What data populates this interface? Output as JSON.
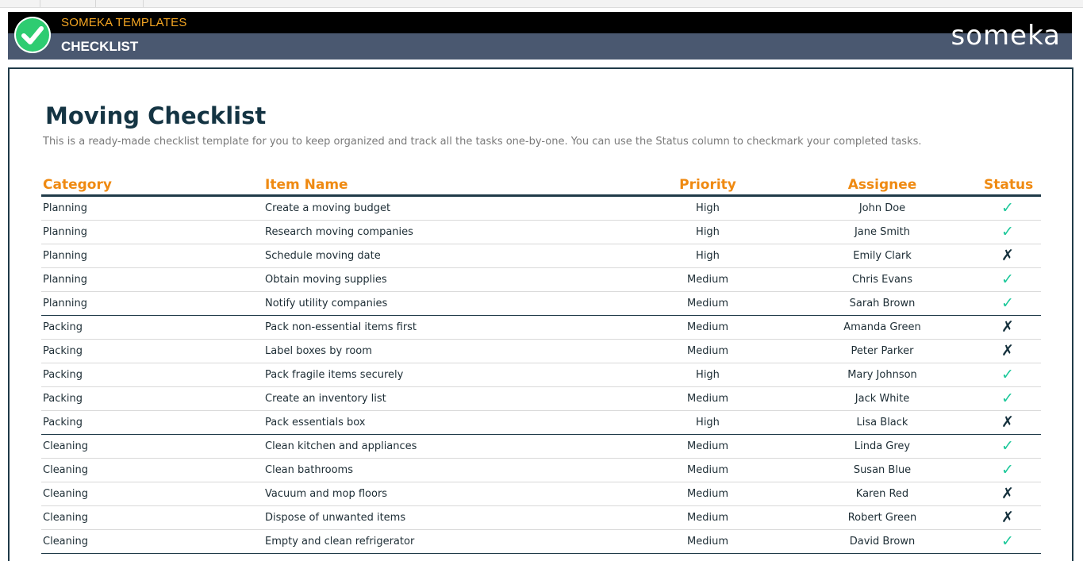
{
  "header": {
    "brand": "SOMEKA TEMPLATES",
    "title": "CHECKLIST",
    "logo_text": "someka",
    "check_icon": "check-circle-icon",
    "accent_color": "#f5a623",
    "band_color": "#4a5870"
  },
  "main": {
    "title": "Moving Checklist",
    "description": "This is a ready-made checklist template for you to keep organized and track all the tasks one-by-one. You can use the Status column to checkmark your completed tasks."
  },
  "table": {
    "columns": {
      "category": "Category",
      "item_name": "Item Name",
      "priority": "Priority",
      "assignee": "Assignee",
      "status": "Status"
    },
    "header_color": "#ef8a12",
    "status_done_symbol": "✓",
    "status_not_done_symbol": "✗",
    "status_done_color": "#1cc89a",
    "status_not_done_color": "#14303c",
    "rows": [
      {
        "category": "Planning",
        "item": "Create a moving budget",
        "priority": "High",
        "assignee": "John Doe",
        "status": "✓"
      },
      {
        "category": "Planning",
        "item": "Research moving companies",
        "priority": "High",
        "assignee": "Jane Smith",
        "status": "✓"
      },
      {
        "category": "Planning",
        "item": "Schedule moving date",
        "priority": "High",
        "assignee": "Emily Clark",
        "status": "✗"
      },
      {
        "category": "Planning",
        "item": "Obtain moving supplies",
        "priority": "Medium",
        "assignee": "Chris Evans",
        "status": "✓"
      },
      {
        "category": "Planning",
        "item": "Notify utility companies",
        "priority": "Medium",
        "assignee": "Sarah Brown",
        "status": "✓"
      },
      {
        "category": "Packing",
        "item": "Pack non-essential items first",
        "priority": "Medium",
        "assignee": "Amanda Green",
        "status": "✗"
      },
      {
        "category": "Packing",
        "item": "Label boxes by room",
        "priority": "Medium",
        "assignee": "Peter Parker",
        "status": "✗"
      },
      {
        "category": "Packing",
        "item": "Pack fragile items securely",
        "priority": "High",
        "assignee": "Mary Johnson",
        "status": "✓"
      },
      {
        "category": "Packing",
        "item": "Create an inventory list",
        "priority": "Medium",
        "assignee": "Jack White",
        "status": "✓"
      },
      {
        "category": "Packing",
        "item": "Pack essentials box",
        "priority": "High",
        "assignee": "Lisa Black",
        "status": "✗"
      },
      {
        "category": "Cleaning",
        "item": "Clean kitchen and appliances",
        "priority": "Medium",
        "assignee": "Linda Grey",
        "status": "✓"
      },
      {
        "category": "Cleaning",
        "item": "Clean bathrooms",
        "priority": "Medium",
        "assignee": "Susan Blue",
        "status": "✓"
      },
      {
        "category": "Cleaning",
        "item": "Vacuum and mop floors",
        "priority": "Medium",
        "assignee": "Karen Red",
        "status": "✗"
      },
      {
        "category": "Cleaning",
        "item": "Dispose of unwanted items",
        "priority": "Medium",
        "assignee": "Robert Green",
        "status": "✗"
      },
      {
        "category": "Cleaning",
        "item": "Empty and clean refrigerator",
        "priority": "Medium",
        "assignee": "David Brown",
        "status": "✓"
      }
    ]
  }
}
